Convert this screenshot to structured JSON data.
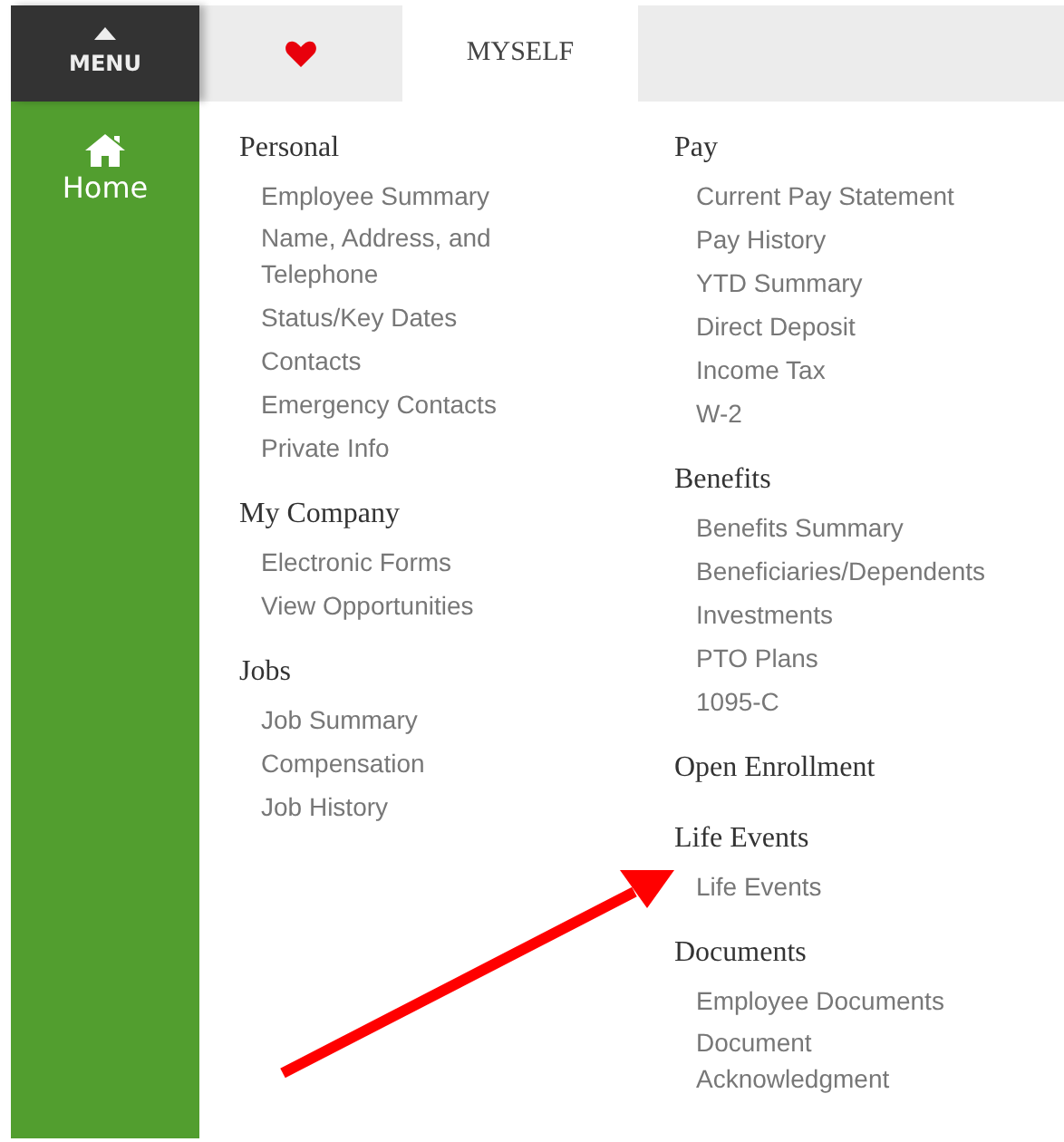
{
  "menu_button": {
    "label": "MENU"
  },
  "sidebar": {
    "items": [
      {
        "label": "Home"
      }
    ]
  },
  "tabs": [
    {
      "kind": "heart",
      "selected": false
    },
    {
      "kind": "text",
      "label": "MYSELF",
      "selected": true
    }
  ],
  "columns": [
    {
      "sections": [
        {
          "heading": "Personal",
          "items": [
            "Employee Summary",
            "Name, Address, and\nTelephone",
            "Status/Key Dates",
            "Contacts",
            "Emergency Contacts",
            "Private Info"
          ]
        },
        {
          "heading": "My Company",
          "items": [
            "Electronic Forms",
            "View Opportunities"
          ]
        },
        {
          "heading": "Jobs",
          "items": [
            "Job Summary",
            "Compensation",
            "Job History"
          ]
        }
      ]
    },
    {
      "sections": [
        {
          "heading": "Pay",
          "items": [
            "Current Pay Statement",
            "Pay History",
            "YTD Summary",
            "Direct Deposit",
            "Income Tax",
            "W-2"
          ]
        },
        {
          "heading": "Benefits",
          "items": [
            "Benefits Summary",
            "Beneficiaries/Dependents",
            "Investments",
            "PTO Plans",
            "1095-C"
          ]
        },
        {
          "heading": "Open Enrollment"
        },
        {
          "heading": "Life Events",
          "items": [
            "Life Events"
          ]
        },
        {
          "heading": "Documents",
          "items": [
            "Employee Documents",
            "Document\nAcknowledgment"
          ]
        }
      ]
    }
  ]
}
